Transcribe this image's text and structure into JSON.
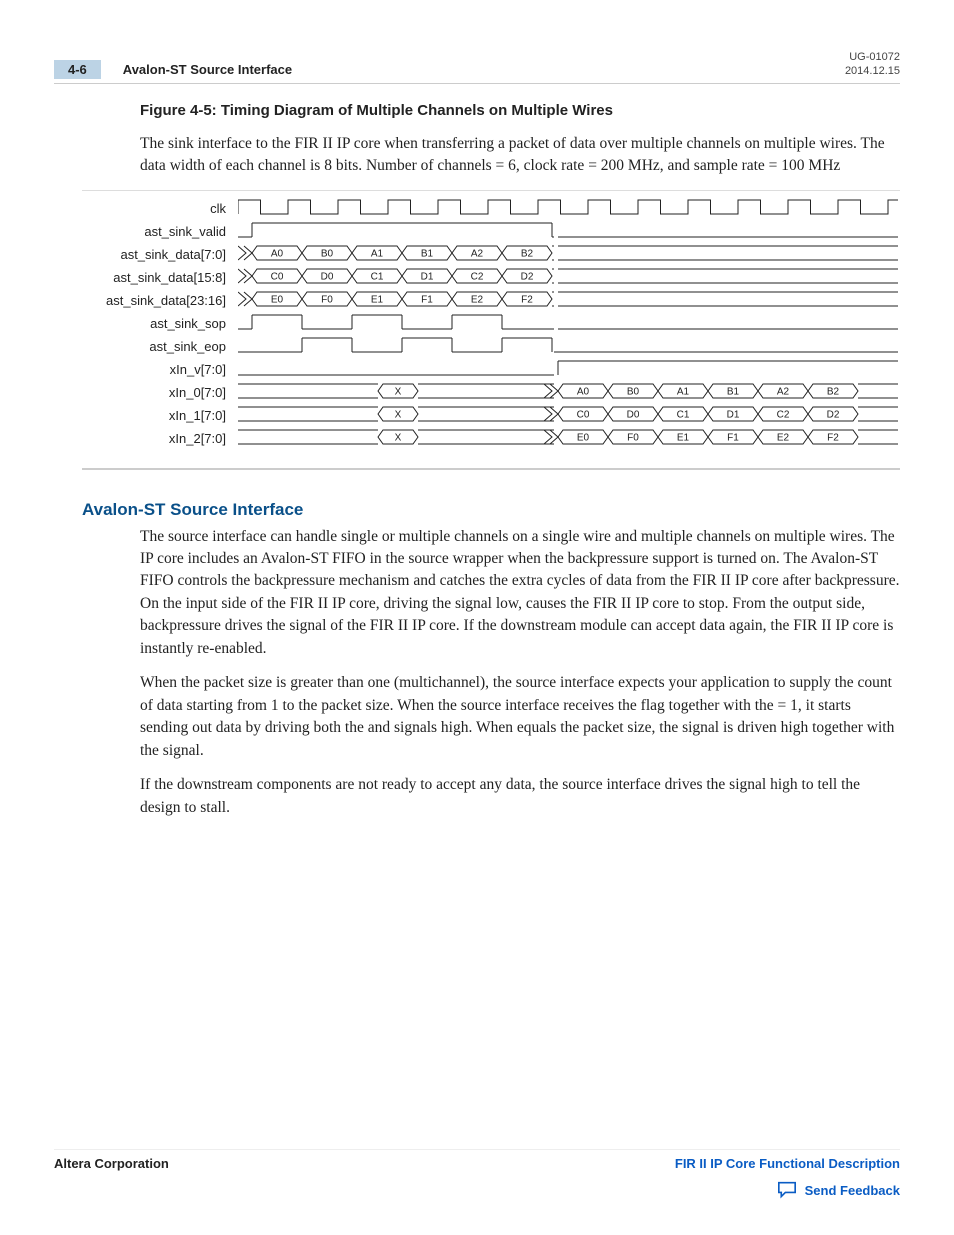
{
  "header": {
    "page_num": "4-6",
    "section_ref": "Avalon-ST Source Interface",
    "doc_code": "UG-01072",
    "date": "2014.12.15"
  },
  "figure_title": "Figure 4-5: Timing Diagram of Multiple Channels on Multiple Wires",
  "figure_caption": "The sink interface to the FIR II IP core when transferring a packet of data over multiple channels on multiple wires. The data width of each channel is 8 bits. Number of channels = 6, clock rate = 200 MHz, and sample rate = 100 MHz",
  "timing": {
    "signals": [
      {
        "name": "clk",
        "type": "clock"
      },
      {
        "name": "ast_sink_valid",
        "type": "valid"
      },
      {
        "name": "ast_sink_data[7:0]",
        "type": "bus",
        "early": [
          "A0",
          "B0",
          "A1",
          "B1",
          "A2",
          "B2"
        ]
      },
      {
        "name": "ast_sink_data[15:8]",
        "type": "bus",
        "early": [
          "C0",
          "D0",
          "C1",
          "D1",
          "C2",
          "D2"
        ]
      },
      {
        "name": "ast_sink_data[23:16]",
        "type": "bus",
        "early": [
          "E0",
          "F0",
          "E1",
          "F1",
          "E2",
          "F2"
        ]
      },
      {
        "name": "ast_sink_sop",
        "type": "sop"
      },
      {
        "name": "ast_sink_eop",
        "type": "eop"
      },
      {
        "name": "xIn_v[7:0]",
        "type": "xv"
      },
      {
        "name": "xIn_0[7:0]",
        "type": "xbus",
        "late": [
          "A0",
          "B0",
          "A1",
          "B1",
          "A2",
          "B2"
        ]
      },
      {
        "name": "xIn_1[7:0]",
        "type": "xbus",
        "late": [
          "C0",
          "D0",
          "C1",
          "D1",
          "C2",
          "D2"
        ]
      },
      {
        "name": "xIn_2[7:0]",
        "type": "xbus",
        "late": [
          "E0",
          "F0",
          "E1",
          "F1",
          "E2",
          "F2"
        ]
      }
    ]
  },
  "section_title": "Avalon-ST Source Interface",
  "para1": "The source interface can handle single or multiple channels on a single wire and multiple channels on multiple wires. The IP core includes an Avalon-ST FIFO in the source wrapper when the backpressure support is turned on. The Avalon-ST FIFO controls the backpressure mechanism and catches the extra cycles of data from the FIR II IP core after backpressure. On the input side of the FIR II IP core, driving the                     signal low, causes the FIR II IP core to stop. From the output side, backpressure drives the                  signal of the FIR II IP core. If the downstream module can accept data again, the FIR II IP core is instantly re-enabled.",
  "para2": "When the packet size is greater than one (multichannel), the source interface expects your application to supply the count of data starting from 1 to the packet size. When the source interface receives the flag together with the                           = 1, it starts sending out data by driving both the                               and                                  signals high. When                            equals the packet size, the                                 signal is driven high together with the                                 signal.",
  "para3": "If the downstream components are not ready to accept any data, the source interface drives the                  signal high to tell the design to stall.",
  "footer": {
    "company": "Altera Corporation",
    "doc_title": "FIR II IP Core Functional Description",
    "feedback": "Send Feedback"
  }
}
